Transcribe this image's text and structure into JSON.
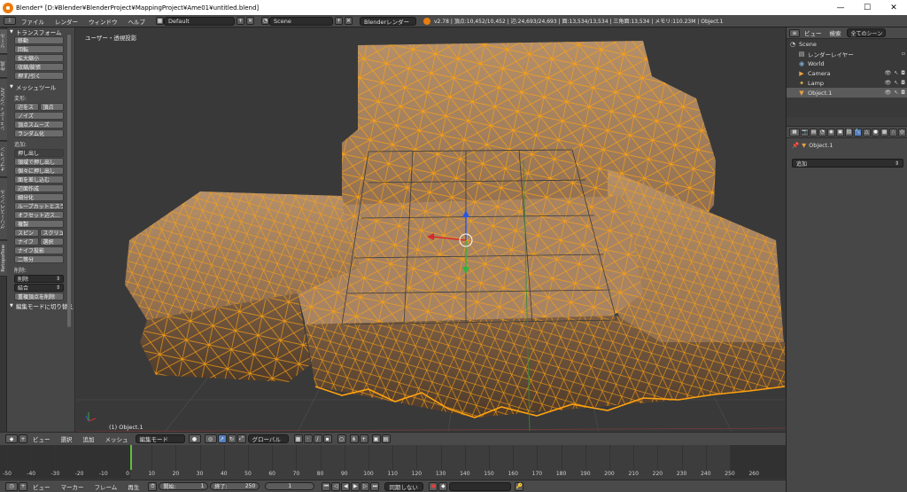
{
  "window": {
    "title": "Blender* [D:¥Blender¥BlenderProject¥MappingProject¥Ame01¥untitled.blend]",
    "min": "—",
    "max": "☐",
    "close": "✕"
  },
  "info": {
    "menus": [
      "ファイル",
      "レンダー",
      "ウィンドウ",
      "ヘルプ"
    ],
    "layout": "Default",
    "scene": "Scene",
    "engine": "Blenderレンダー",
    "stats": "v2.78 | 頂点:10,452/10,452 | 辺:24,693/24,693 | 面:13,534/13,534 | 三角面:13,534 | メモリ:110.23M | Object.1"
  },
  "tabs_vertical": [
    "ツール",
    "作成",
    "シェーディング/UV",
    "オプション",
    "グリースペンシル",
    "Retopoflow"
  ],
  "toolshelf": {
    "transform_header": "トランスフォーム",
    "transform": [
      "移動",
      "回転",
      "拡大縮小",
      "収縮/膨張",
      "押す/引く"
    ],
    "mesh_tools_header": "メッシュツール",
    "deform_label": "変形:",
    "slide_edge": "辺をス",
    "slide_vertex": "頂点",
    "noise": "ノイズ",
    "smooth_vertex": "頂点スムーズ",
    "randomize": "ランダム化",
    "add_label": "追加:",
    "add": [
      "押し出し",
      "領域で押し出し",
      "個々に押し出し",
      "面を差し込む",
      "辺面作成",
      "細分化",
      "ループカットとスライド",
      "オフセット辺ス..."
    ],
    "duplicate": "複製",
    "spin": "スピン",
    "screw": "スクリュ",
    "knife": "ナイフ",
    "select": "選択",
    "knife_project": "ナイフ投影",
    "bisect": "二等分",
    "remove_label": "削除:",
    "delete": "削除",
    "merge": "結合",
    "remove_doubles": "重複頂点を削除",
    "toggle_editmode": "編集モードに切り替え"
  },
  "viewport": {
    "view_name": "ユーザー・透視投影",
    "object_label": "(1) Object.1"
  },
  "view3d_header": {
    "menus": [
      "ビュー",
      "選択",
      "追加",
      "メッシュ"
    ],
    "mode": "編集モード",
    "orientation": "グローバル"
  },
  "timeline": {
    "ticks": [
      -50,
      -40,
      -30,
      -20,
      -10,
      0,
      10,
      20,
      30,
      40,
      50,
      60,
      70,
      80,
      90,
      100,
      110,
      120,
      130,
      140,
      150,
      160,
      170,
      180,
      190,
      200,
      210,
      220,
      230,
      240,
      250,
      260
    ],
    "current_frame": 1,
    "start": 1,
    "end": 250
  },
  "timeline_header": {
    "menus": [
      "ビュー",
      "マーカー",
      "フレーム",
      "再生"
    ],
    "start_label": "開始:",
    "start_value": "1",
    "end_label": "終了:",
    "end_value": "250",
    "current": "1",
    "sync": "同期しない"
  },
  "outliner": {
    "tabs": [
      "ビュー",
      "検索",
      "全てのシーン"
    ],
    "items": [
      {
        "name": "Scene",
        "icon": "scene-icon"
      },
      {
        "name": "レンダーレイヤー",
        "icon": "renderlayer-icon"
      },
      {
        "name": "World",
        "icon": "world-icon"
      },
      {
        "name": "Camera",
        "icon": "camera-icon"
      },
      {
        "name": "Lamp",
        "icon": "lamp-icon"
      },
      {
        "name": "Object.1",
        "icon": "mesh-icon"
      }
    ]
  },
  "properties": {
    "path_object": "Object.1",
    "add_modifier": "追加"
  },
  "colors": {
    "wire": "#ffa20f",
    "mesh_fill": "#b08a64",
    "viewport_bg": "#393939",
    "active_button": "#5680c2"
  }
}
